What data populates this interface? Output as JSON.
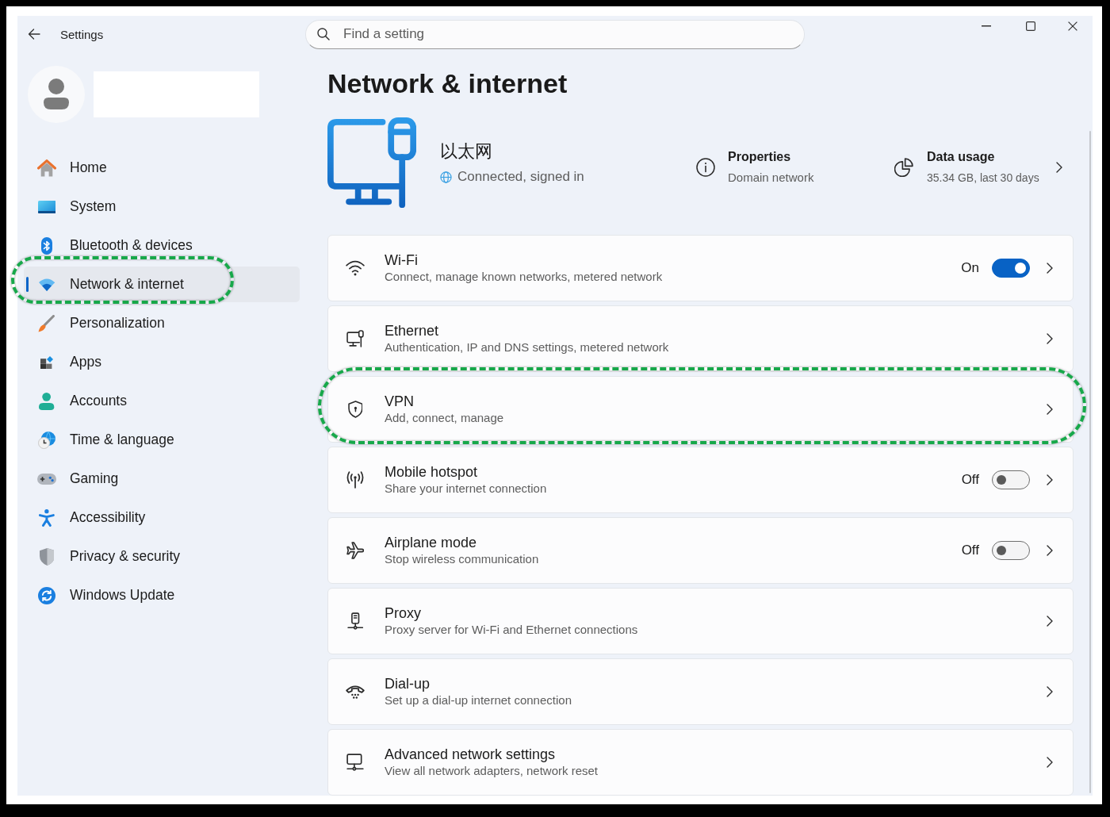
{
  "window": {
    "title": "Settings"
  },
  "search": {
    "placeholder": "Find a setting"
  },
  "sidebar": {
    "items": [
      {
        "label": "Home",
        "selected": false,
        "highlighted": false
      },
      {
        "label": "System",
        "selected": false,
        "highlighted": false
      },
      {
        "label": "Bluetooth & devices",
        "selected": false,
        "highlighted": false
      },
      {
        "label": "Network & internet",
        "selected": true,
        "highlighted": true
      },
      {
        "label": "Personalization",
        "selected": false,
        "highlighted": false
      },
      {
        "label": "Apps",
        "selected": false,
        "highlighted": false
      },
      {
        "label": "Accounts",
        "selected": false,
        "highlighted": false
      },
      {
        "label": "Time & language",
        "selected": false,
        "highlighted": false
      },
      {
        "label": "Gaming",
        "selected": false,
        "highlighted": false
      },
      {
        "label": "Accessibility",
        "selected": false,
        "highlighted": false
      },
      {
        "label": "Privacy & security",
        "selected": false,
        "highlighted": false
      },
      {
        "label": "Windows Update",
        "selected": false,
        "highlighted": false
      }
    ]
  },
  "page": {
    "title": "Network & internet",
    "connection": {
      "name": "以太网",
      "status": "Connected, signed in"
    },
    "properties": {
      "title": "Properties",
      "subtitle": "Domain network"
    },
    "data_usage": {
      "title": "Data usage",
      "subtitle": "35.34 GB, last 30 days"
    },
    "settings": [
      {
        "kind": "toggle",
        "title": "Wi-Fi",
        "subtitle": "Connect, manage known networks, metered network",
        "on": true,
        "state_label": "On",
        "highlighted": false
      },
      {
        "kind": "link",
        "title": "Ethernet",
        "subtitle": "Authentication, IP and DNS settings, metered network",
        "highlighted": false
      },
      {
        "kind": "link",
        "title": "VPN",
        "subtitle": "Add, connect, manage",
        "highlighted": true
      },
      {
        "kind": "toggle",
        "title": "Mobile hotspot",
        "subtitle": "Share your internet connection",
        "on": false,
        "state_label": "Off",
        "highlighted": false
      },
      {
        "kind": "toggle",
        "title": "Airplane mode",
        "subtitle": "Stop wireless communication",
        "on": false,
        "state_label": "Off",
        "highlighted": false
      },
      {
        "kind": "link",
        "title": "Proxy",
        "subtitle": "Proxy server for Wi-Fi and Ethernet connections",
        "highlighted": false
      },
      {
        "kind": "link",
        "title": "Dial-up",
        "subtitle": "Set up a dial-up internet connection",
        "highlighted": false
      },
      {
        "kind": "link",
        "title": "Advanced network settings",
        "subtitle": "View all network adapters, network reset",
        "highlighted": false
      }
    ]
  }
}
